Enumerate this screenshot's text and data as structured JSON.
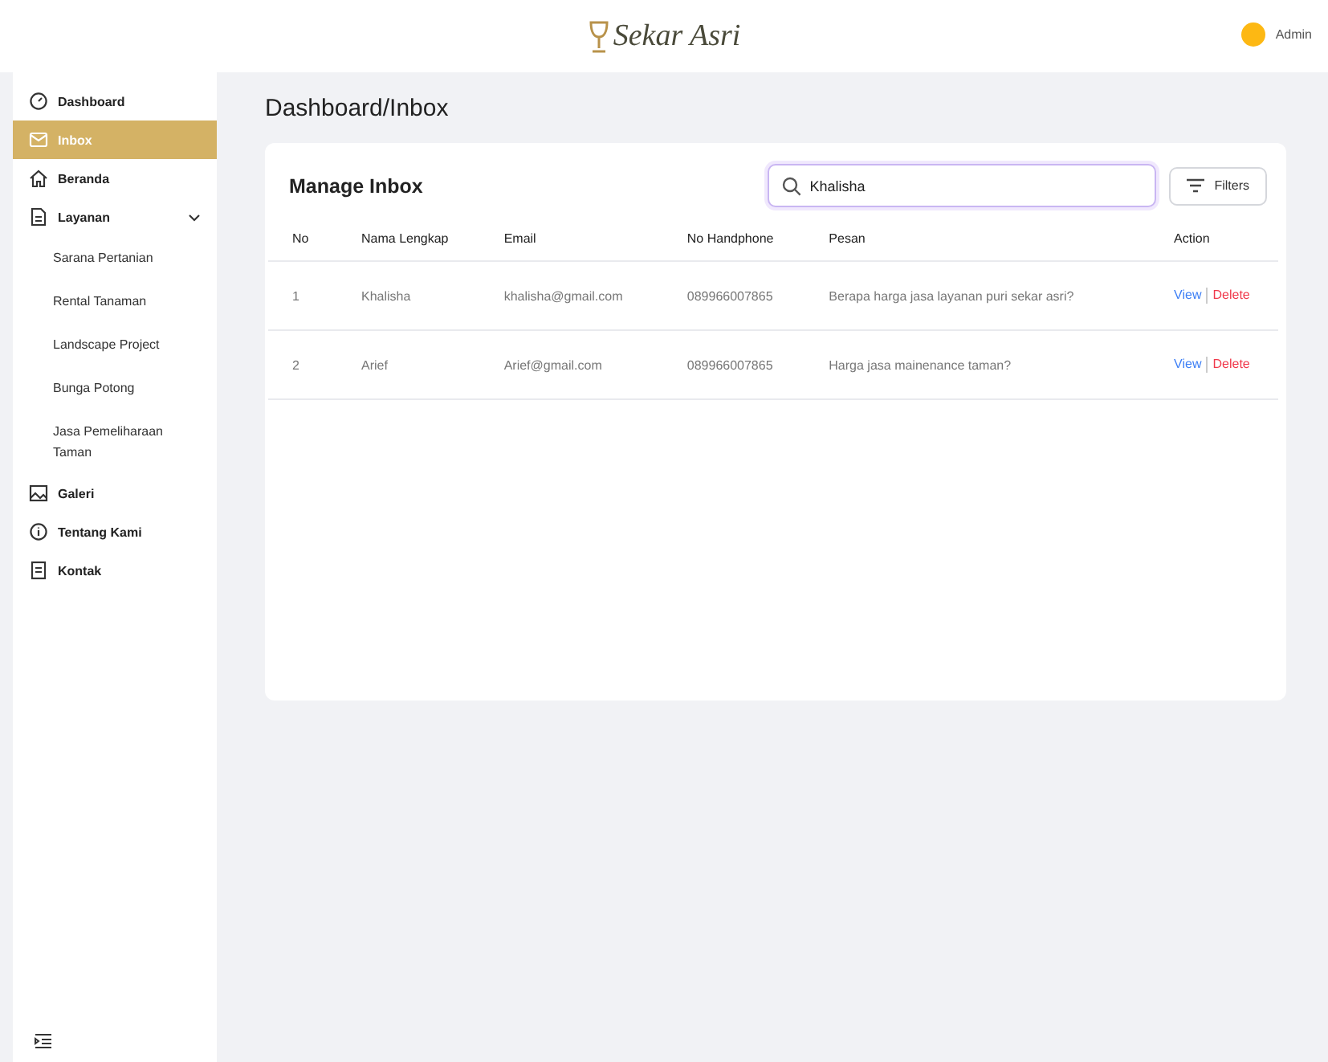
{
  "header": {
    "logo_text": "Sekar Asri",
    "user": {
      "name": "Admin"
    }
  },
  "sidebar": {
    "items": [
      {
        "label": "Dashboard",
        "selected": false
      },
      {
        "label": "Inbox",
        "selected": true
      },
      {
        "label": "Beranda",
        "selected": false
      },
      {
        "label": "Layanan",
        "selected": false,
        "expanded": true,
        "children": [
          {
            "label": "Sarana Pertanian",
            "selected": false
          },
          {
            "label": "Rental Tanaman",
            "selected": false
          },
          {
            "label": "Landscape Project",
            "selected": false
          },
          {
            "label": "Bunga Potong",
            "selected": false
          },
          {
            "label": "Jasa Pemeliharaan Taman",
            "selected": false
          }
        ]
      },
      {
        "label": "Galeri",
        "selected": false
      },
      {
        "label": "Tentang Kami",
        "selected": false
      },
      {
        "label": "Kontak",
        "selected": false
      }
    ]
  },
  "page_title": "Dashboard/Inbox",
  "card": {
    "title": "Manage Inbox",
    "search": {
      "value": "Khalisha"
    },
    "filters_button": "Filters",
    "table": {
      "columns": [
        "No",
        "Nama Lengkap",
        "Email",
        "No Handphone",
        "Pesan",
        "Action"
      ],
      "rows": [
        {
          "cells": [
            "1",
            "Khalisha",
            "khalisha@gmail.com",
            "089966007865",
            "Berapa harga jasa layanan puri sekar asri?"
          ],
          "actions": [
            "View",
            "Delete"
          ]
        },
        {
          "cells": [
            "2",
            "Arief",
            "Arief@gmail.com",
            "089966007865",
            "Harga jasa mainenance taman?"
          ],
          "actions": [
            "View",
            "Delete"
          ]
        }
      ]
    }
  }
}
